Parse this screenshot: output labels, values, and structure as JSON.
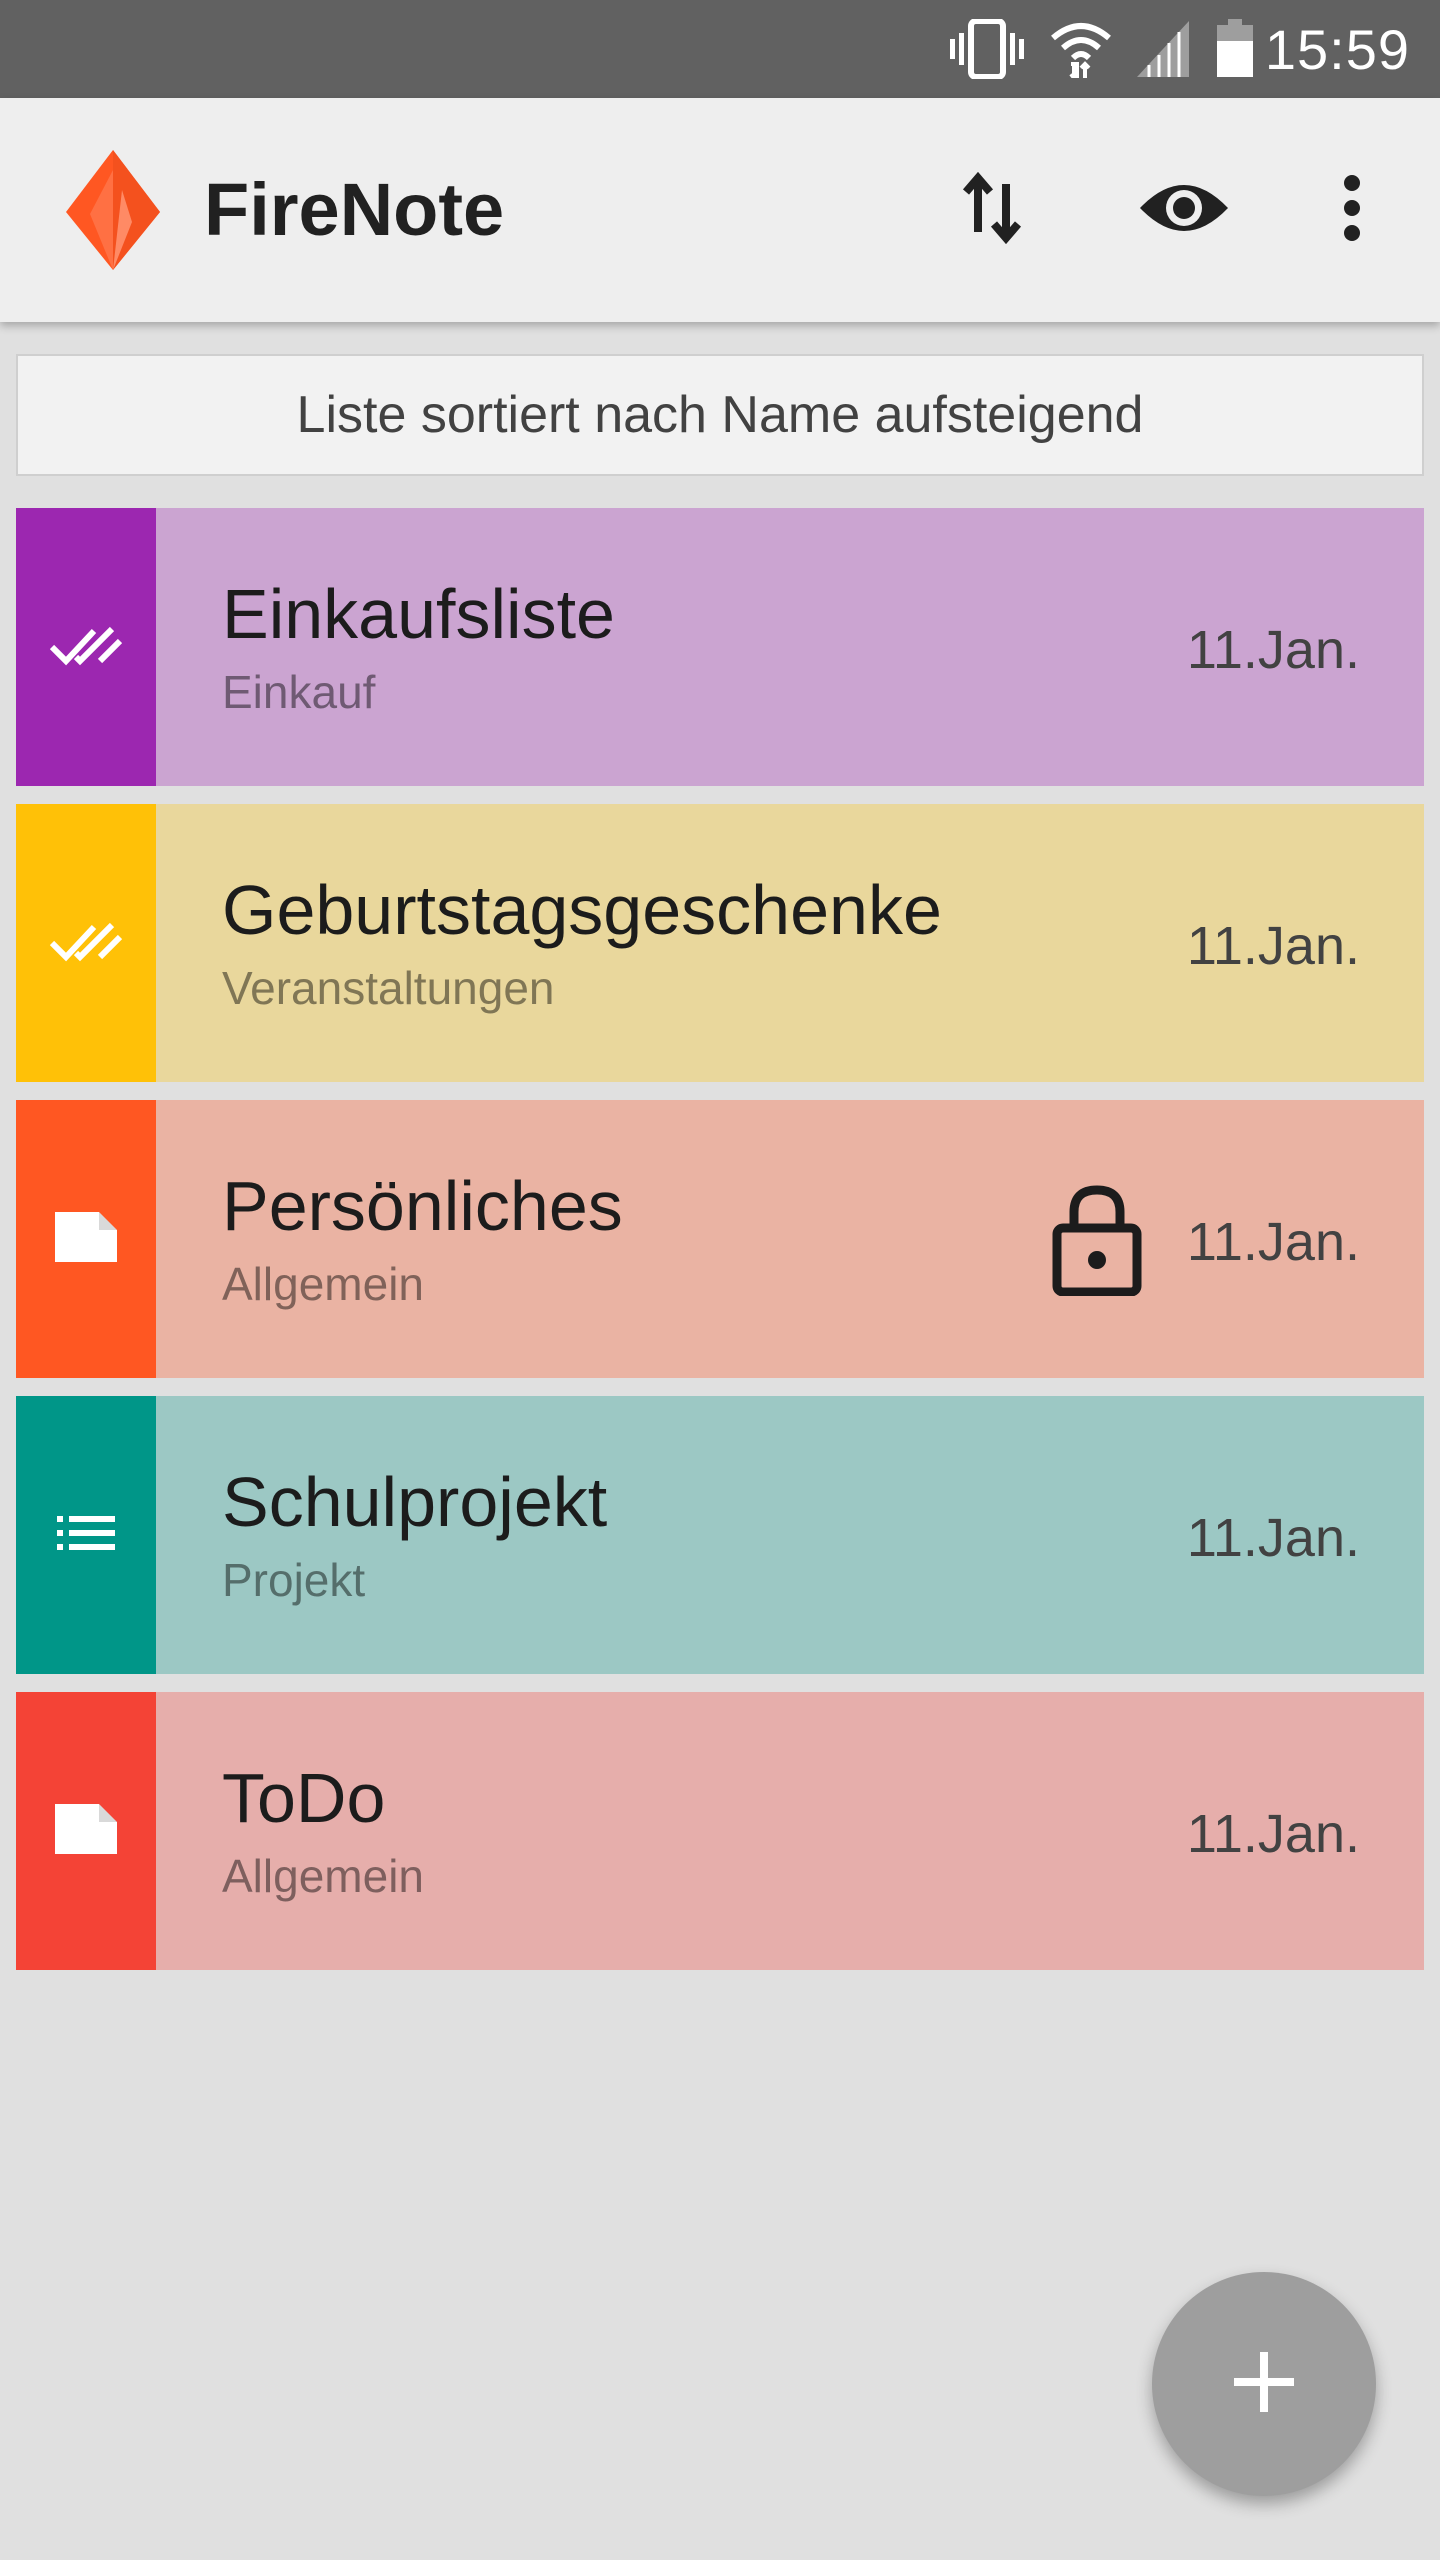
{
  "status_bar": {
    "time": "15:59",
    "icons": [
      "vibrate-icon",
      "wifi-icon",
      "signal-icon",
      "battery-icon"
    ]
  },
  "app_bar": {
    "title": "FireNote",
    "logo_icon": "firenote-flame-icon",
    "actions": [
      "sort-icon",
      "eye-icon",
      "more-vert-icon"
    ]
  },
  "sort_banner": {
    "text": "Liste sortiert nach Name aufsteigend"
  },
  "notes": [
    {
      "title": "Einkaufsliste",
      "category": "Einkauf",
      "date": "11.Jan.",
      "icon": "double-check-icon",
      "strip_color": "#9c27b0",
      "bg_color": "#cba4d1",
      "locked": false
    },
    {
      "title": "Geburtstagsgeschenke",
      "category": "Veranstaltungen",
      "date": "11.Jan.",
      "icon": "double-check-icon",
      "strip_color": "#ffc107",
      "bg_color": "#e9d79c",
      "locked": false
    },
    {
      "title": "Persönliches",
      "category": "Allgemein",
      "date": "11.Jan.",
      "icon": "note-icon",
      "strip_color": "#ff5722",
      "bg_color": "#eab3a3",
      "locked": true
    },
    {
      "title": "Schulprojekt",
      "category": "Projekt",
      "date": "11.Jan.",
      "icon": "list-icon",
      "strip_color": "#009688",
      "bg_color": "#9cc8c4",
      "locked": false
    },
    {
      "title": "ToDo",
      "category": "Allgemein",
      "date": "11.Jan.",
      "icon": "note-icon",
      "strip_color": "#f44336",
      "bg_color": "#e6aeab",
      "locked": false
    }
  ],
  "fab": {
    "icon": "plus-icon"
  }
}
